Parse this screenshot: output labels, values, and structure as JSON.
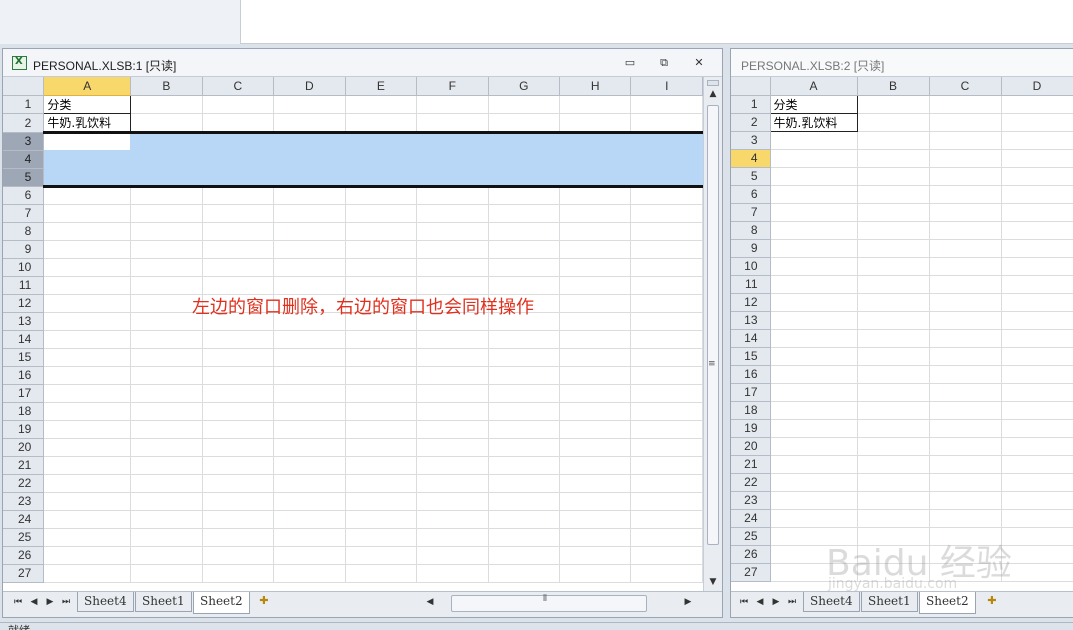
{
  "left_window": {
    "title": "PERSONAL.XLSB:1  [只读]",
    "buttons": {
      "minimize": "▭",
      "restore": "⧉",
      "close": "✕"
    },
    "columns": [
      "A",
      "B",
      "C",
      "D",
      "E",
      "F",
      "G",
      "H",
      "I"
    ],
    "rows": [
      "1",
      "2",
      "3",
      "4",
      "5",
      "6",
      "7",
      "8",
      "9",
      "10",
      "11",
      "12",
      "13",
      "14",
      "15",
      "16",
      "17",
      "18",
      "19",
      "20",
      "21",
      "22",
      "23",
      "24",
      "25",
      "26",
      "27"
    ],
    "cells": {
      "A1": "分类",
      "A2": "牛奶.乳饮料"
    },
    "selected_rows": [
      "3",
      "4",
      "5"
    ],
    "active_column": "A",
    "annotation": "左边的窗口删除，右边的窗口也会同样操作",
    "tabs": [
      "Sheet4",
      "Sheet1",
      "Sheet2"
    ],
    "active_tab": "Sheet2"
  },
  "right_window": {
    "title": "PERSONAL.XLSB:2  [只读]",
    "columns": [
      "A",
      "B",
      "C",
      "D"
    ],
    "rows": [
      "1",
      "2",
      "3",
      "4",
      "5",
      "6",
      "7",
      "8",
      "9",
      "10",
      "11",
      "12",
      "13",
      "14",
      "15",
      "16",
      "17",
      "18",
      "19",
      "20",
      "21",
      "22",
      "23",
      "24",
      "25",
      "26",
      "27"
    ],
    "cells": {
      "A1": "分类",
      "A2": "牛奶.乳饮料"
    },
    "active_row": "4",
    "tabs": [
      "Sheet4",
      "Sheet1",
      "Sheet2"
    ],
    "active_tab": "Sheet2"
  },
  "nav_icons": {
    "first": "⏮",
    "prev": "◀",
    "next": "▶",
    "last": "⏭"
  },
  "watermark": {
    "main": "Baidu 经验",
    "sub": "jingyan.baidu.com"
  },
  "status": {
    "text": "就绪"
  },
  "colors": {
    "selection": "#b8d6f6",
    "active_header": "#f9d86b",
    "annotation": "#e0301e"
  }
}
